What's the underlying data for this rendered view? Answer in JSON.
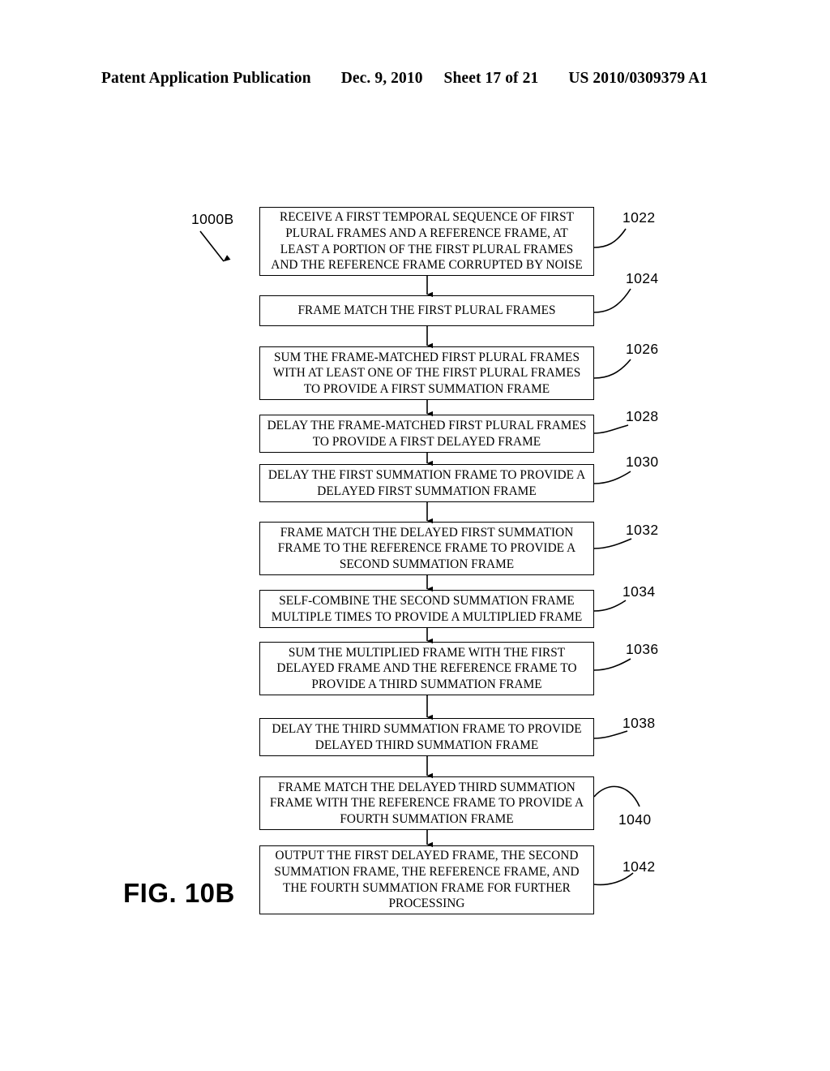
{
  "header": {
    "publication": "Patent Application Publication",
    "date": "Dec. 9, 2010",
    "sheet": "Sheet 17 of 21",
    "patent_number": "US 2010/0309379 A1"
  },
  "figure": {
    "caption": "FIG. 10B",
    "diagram_label": "1000B"
  },
  "flowchart": {
    "steps": [
      {
        "ref": "1022",
        "text": "RECEIVE A FIRST TEMPORAL SEQUENCE OF FIRST PLURAL FRAMES AND A REFERENCE FRAME, AT LEAST A PORTION OF THE FIRST PLURAL FRAMES AND THE REFERENCE FRAME CORRUPTED BY NOISE"
      },
      {
        "ref": "1024",
        "text": "FRAME MATCH THE FIRST PLURAL FRAMES"
      },
      {
        "ref": "1026",
        "text": "SUM THE FRAME-MATCHED FIRST PLURAL FRAMES WITH AT LEAST ONE OF THE FIRST PLURAL FRAMES TO PROVIDE A FIRST SUMMATION FRAME"
      },
      {
        "ref": "1028",
        "text": "DELAY THE FRAME-MATCHED FIRST PLURAL FRAMES TO PROVIDE A FIRST DELAYED FRAME"
      },
      {
        "ref": "1030",
        "text": "DELAY THE FIRST SUMMATION FRAME TO PROVIDE A DELAYED FIRST SUMMATION FRAME"
      },
      {
        "ref": "1032",
        "text": "FRAME MATCH THE DELAYED FIRST SUMMATION FRAME TO THE REFERENCE FRAME TO PROVIDE A SECOND SUMMATION FRAME"
      },
      {
        "ref": "1034",
        "text": "SELF-COMBINE THE SECOND SUMMATION FRAME MULTIPLE TIMES TO PROVIDE A MULTIPLIED FRAME"
      },
      {
        "ref": "1036",
        "text": "SUM THE MULTIPLIED FRAME WITH THE FIRST DELAYED FRAME AND THE REFERENCE FRAME TO PROVIDE A THIRD SUMMATION FRAME"
      },
      {
        "ref": "1038",
        "text": "DELAY THE THIRD SUMMATION FRAME TO PROVIDE DELAYED THIRD SUMMATION FRAME"
      },
      {
        "ref": "1040",
        "text": "FRAME MATCH THE DELAYED THIRD SUMMATION FRAME WITH THE REFERENCE FRAME TO PROVIDE A FOURTH SUMMATION FRAME"
      },
      {
        "ref": "1042",
        "text": "OUTPUT THE FIRST DELAYED FRAME, THE SECOND SUMMATION FRAME, THE REFERENCE FRAME, AND THE FOURTH SUMMATION FRAME FOR FURTHER PROCESSING"
      }
    ]
  }
}
